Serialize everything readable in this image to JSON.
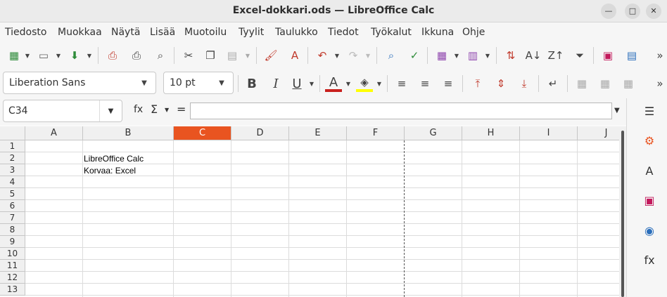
{
  "window": {
    "title": "Excel-dokkari.ods — LibreOffice Calc"
  },
  "menu": [
    "Tiedosto",
    "Muokkaa",
    "Näytä",
    "Lisää",
    "Muotoilu",
    "Tyylit",
    "Taulukko",
    "Tiedot",
    "Työkalut",
    "Ikkuna",
    "Ohje"
  ],
  "format": {
    "font_name": "Liberation Sans",
    "font_size": "10 pt"
  },
  "formula": {
    "name_box": "C34",
    "fx_symbol": "fx",
    "sum_symbol": "Σ",
    "equals_symbol": "=",
    "content": ""
  },
  "sheet": {
    "columns": [
      "A",
      "B",
      "C",
      "D",
      "E",
      "F",
      "G",
      "H",
      "I",
      "J"
    ],
    "active_column": "C",
    "rows": [
      "1",
      "2",
      "3",
      "4",
      "5",
      "6",
      "7",
      "8",
      "9",
      "10",
      "11",
      "12",
      "13"
    ],
    "cells": {
      "B2": "LibreOffice Calc",
      "B3": "Korvaa: Excel"
    }
  },
  "colors": {
    "accent": "#e95420"
  }
}
